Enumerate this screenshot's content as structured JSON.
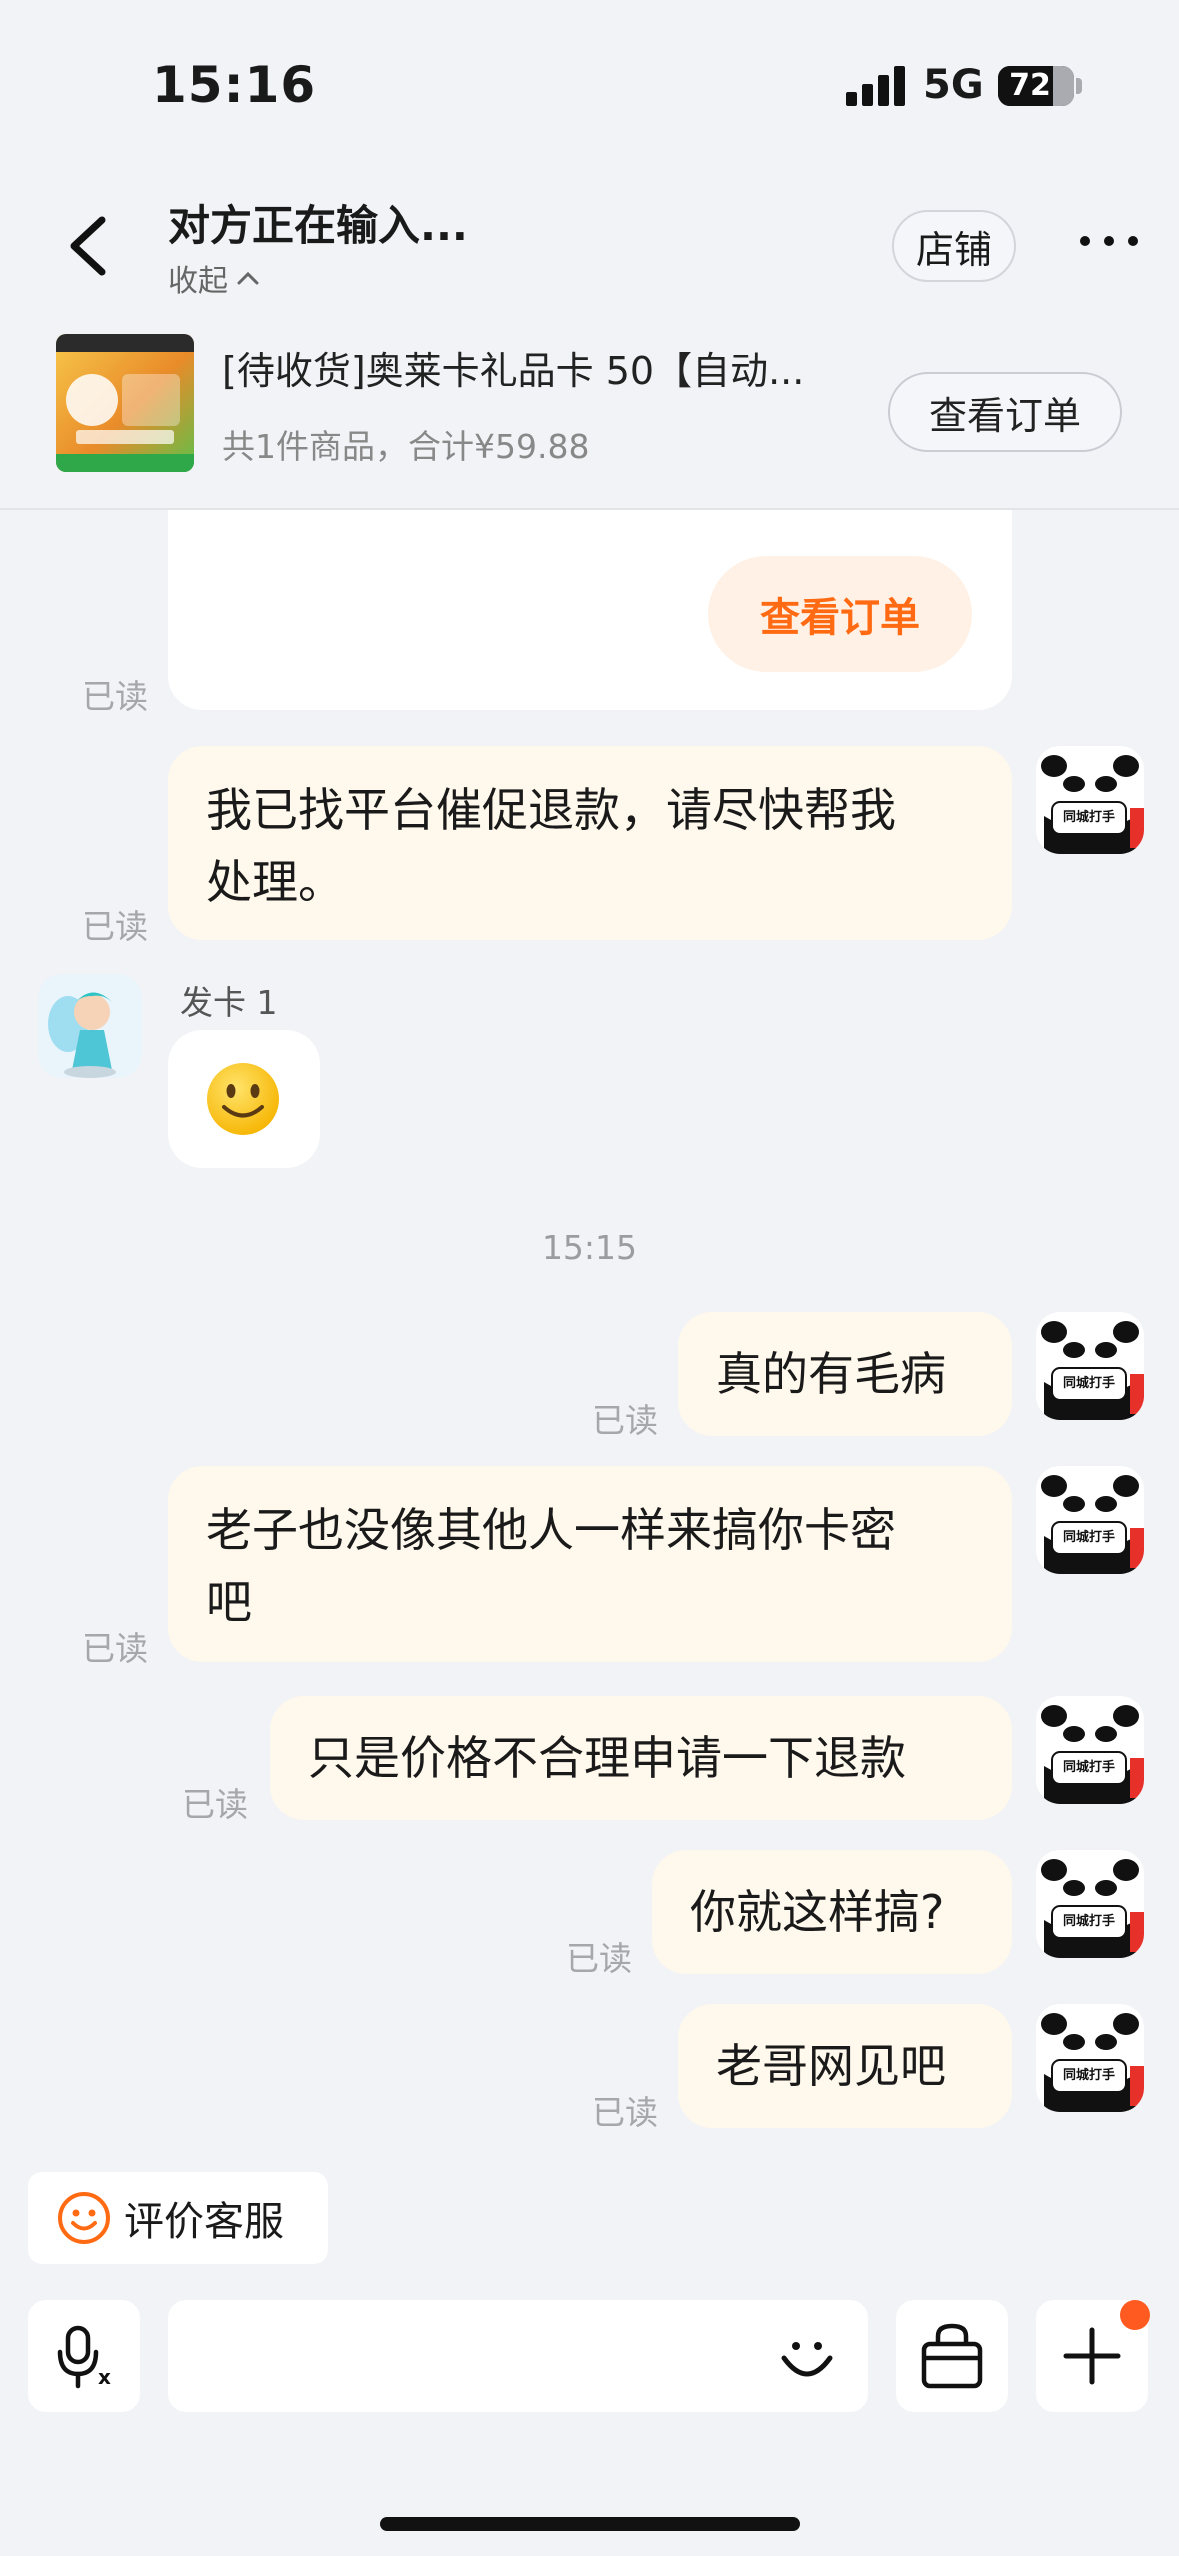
{
  "status_bar": {
    "time": "15:16",
    "network": "5G",
    "battery": "72",
    "battery_level": 0.72
  },
  "header": {
    "title": "对方正在输入...",
    "collapse_label": "收起",
    "shop_label": "店铺"
  },
  "order": {
    "title": "[待收货]奥莱卡礼品卡 50【自动...",
    "summary": "共1件商品，合计¥59.88",
    "view_order_label": "查看订单"
  },
  "messages": {
    "card_button": "查看订单",
    "read_label": "已读",
    "m1": "我已找平台催促退款，请尽快帮我",
    "m1b": "处理。",
    "sender_name": "发卡 1",
    "time_divider": "15:15",
    "m2": "真的有毛病",
    "m3": "老子也没像其他人一样来搞你卡密",
    "m3b": "吧",
    "m4": "只是价格不合理申请一下退款",
    "m5": "你就这样搞?",
    "m6": "老哥网见吧",
    "my_avatar_text": "同城打手"
  },
  "bottom": {
    "rate_label": "评价客服"
  },
  "colors": {
    "accent": "#ff6a13",
    "my_bubble": "#fff8ec",
    "background": "#f1f3f7"
  }
}
